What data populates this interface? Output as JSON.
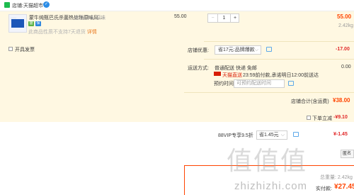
{
  "shop": {
    "label": "店铺:",
    "name": "天猫超市",
    "badge": "✓"
  },
  "product": {
    "title": "蒙牛纯甄巴氏杀菌热处理原味风...",
    "spec": "食品口味:原味",
    "tags": [
      "猫",
      "保"
    ],
    "note": "此商品性质不支持7天退货",
    "note_link": "详情",
    "unit_price": "55.00",
    "quantity": "1",
    "sum_price": "55.00",
    "weight": "2.42kg"
  },
  "invoice": {
    "label": "开具发票"
  },
  "promo": {
    "label": "店铺优惠:",
    "selected": "省17元:品牌爆款",
    "amount": "-17.00"
  },
  "delivery": {
    "label": "运送方式:",
    "methods": "普通配送 快递 免邮",
    "tmall_text": "天猫直送",
    "time": "23:59前付款,承诺明日12:00前送达",
    "appointment_label": "预约时间:",
    "appointment_placeholder": "可预约配送时间",
    "amount": "0.00"
  },
  "shop_total": {
    "label": "店铺合计(含运费)",
    "amount": "¥38.00"
  },
  "reduction": {
    "label": "下单立减",
    "amount": "-¥9.10"
  },
  "vip": {
    "label": "88VIP专享9.5折",
    "selected": "省1.45元",
    "amount": "¥-1.45"
  },
  "side_button": {
    "label": "匿名购买"
  },
  "totals": {
    "weight": "总重量: 2.42kg",
    "pay_label": "实付款:",
    "pay_amount": "¥27.45"
  },
  "watermark": {
    "text": "值值值",
    "url": "zhizhizhi.com"
  },
  "icons": {
    "chat": "chat-bubble-icon",
    "dropdown": "chevron-down-icon"
  },
  "colors": {
    "accent": "#ff4400",
    "panel_bg": "#fff8e2",
    "discount_red": "#e12727"
  }
}
